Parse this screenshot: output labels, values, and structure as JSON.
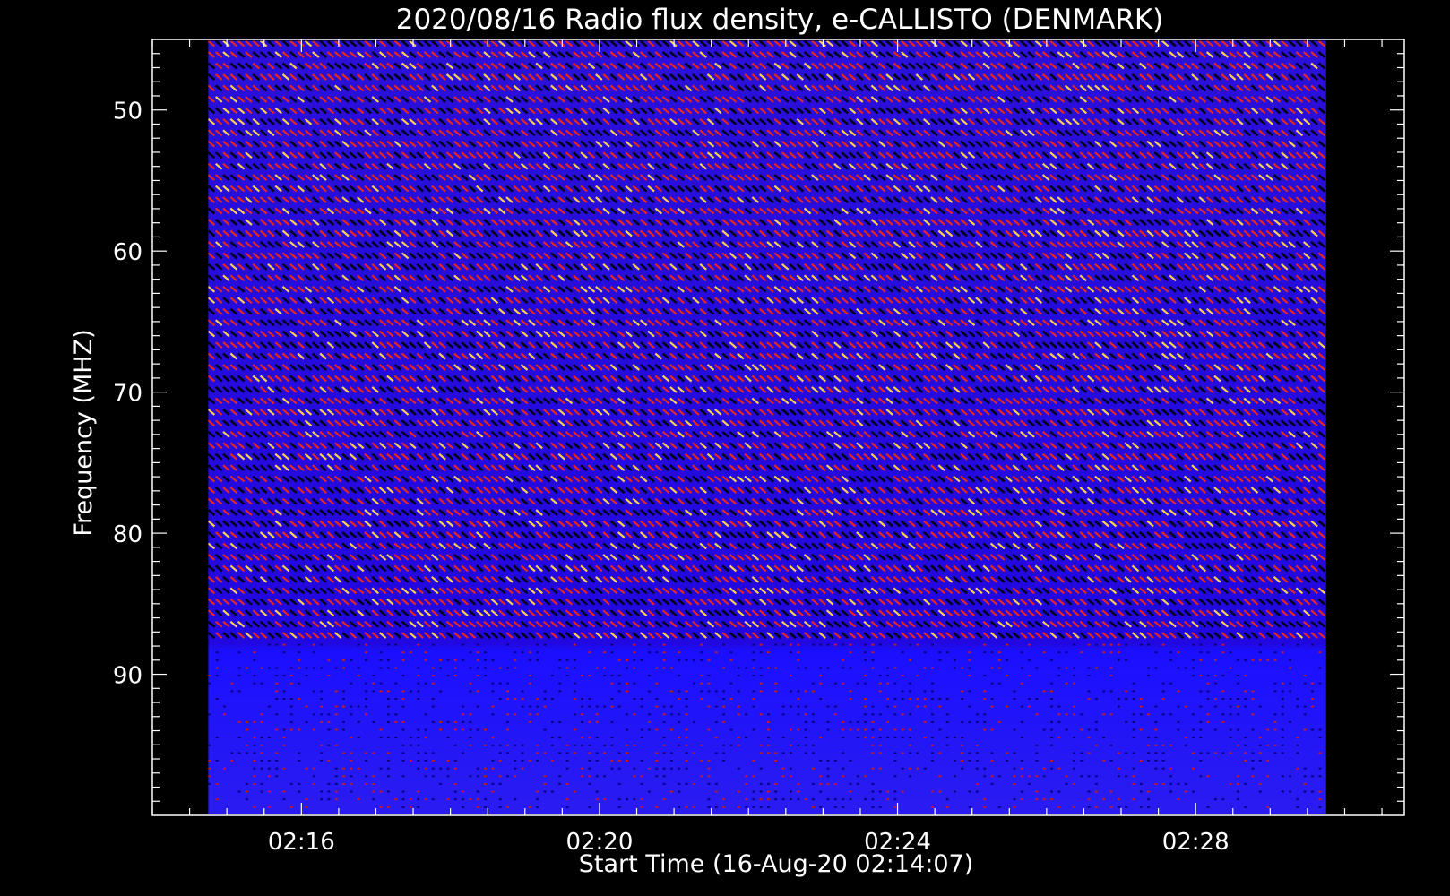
{
  "chart_data": {
    "type": "heatmap",
    "title": "2020/08/16  Radio flux density, e-CALLISTO (DENMARK)",
    "xlabel": "Start Time (16-Aug-20 02:14:07)",
    "ylabel": "Frequency (MHZ)",
    "x_ticks": [
      "02:16",
      "02:20",
      "02:24",
      "02:28"
    ],
    "x_tick_minutes": [
      2,
      6,
      10,
      14
    ],
    "y_ticks": [
      50,
      60,
      70,
      80,
      90
    ],
    "xlim_minutes_from_0214": [
      0,
      16.8
    ],
    "ylim_mhz": [
      45,
      100
    ],
    "data_time_range_minutes_from_0214": [
      0.75,
      15.75
    ],
    "data_freq_range_mhz": [
      45.1,
      99.9
    ],
    "y_inverted": true,
    "colormap": [
      "#000000",
      "#1a00c8",
      "#2a1aff",
      "#d0101a",
      "#ff3010",
      "#ffe060"
    ],
    "background": "#000000"
  }
}
